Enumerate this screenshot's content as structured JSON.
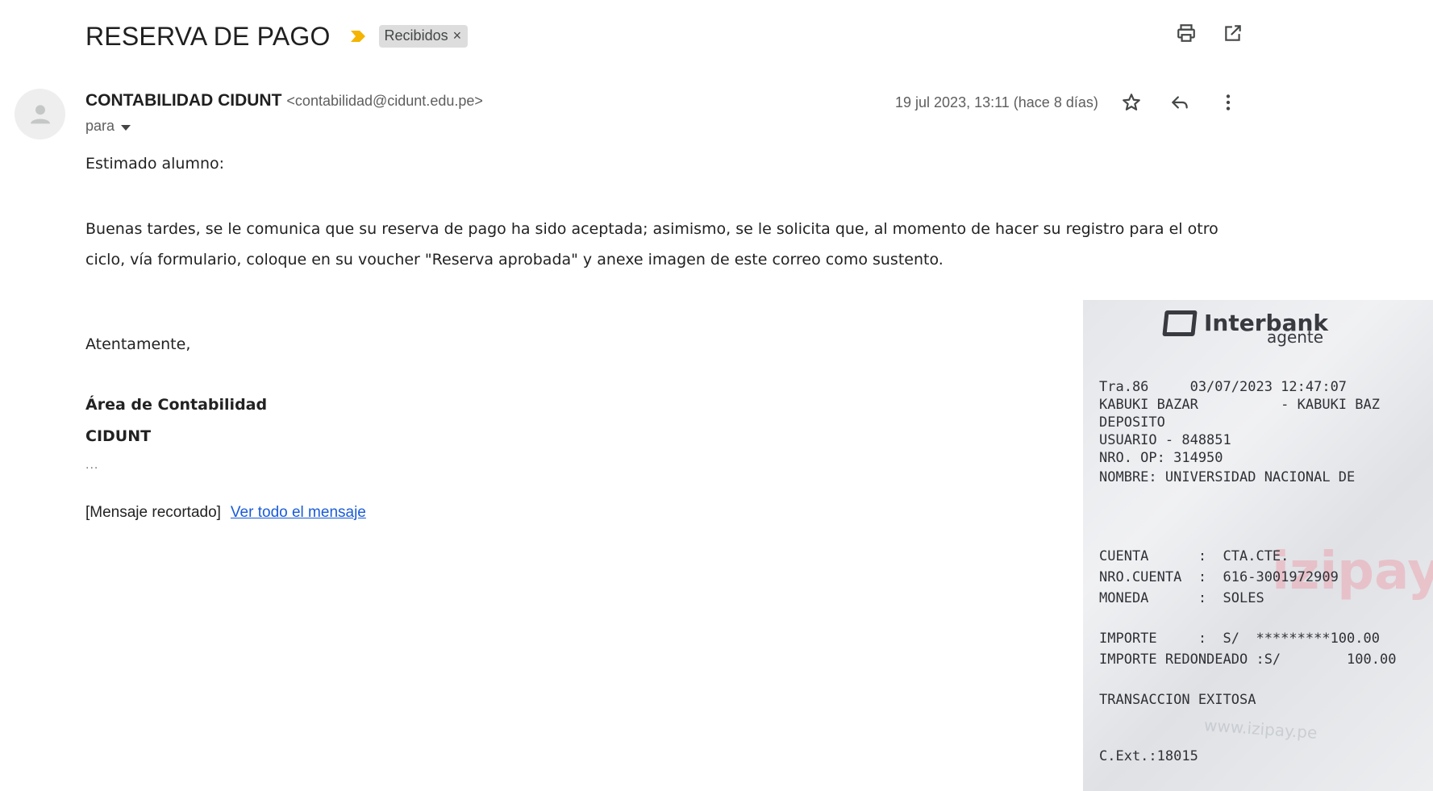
{
  "header": {
    "subject": "RESERVA DE PAGO",
    "label": "Recibidos",
    "label_close": "×",
    "importance_color": "#f4b400"
  },
  "message": {
    "sender_name": "CONTABILIDAD CIDUNT",
    "sender_email": "<contabilidad@cidunt.edu.pe>",
    "to_label": "para",
    "date": "19 jul 2023, 13:11 (hace 8 días)",
    "greeting": "Estimado alumno:",
    "paragraph": "Buenas tardes, se le comunica que su reserva de pago ha sido aceptada; asimismo, se le solicita que, al momento de hacer su registro para el otro ciclo, vía formulario, coloque en su voucher \"Reserva aprobada\" y anexe imagen de este correo como sustento.",
    "closing": "Atentamente,",
    "signature_dept": "Área de Contabilidad",
    "signature_org": "CIDUNT",
    "ellipsis": "...",
    "clipped_text": "[Mensaje recortado]",
    "view_all_link": "Ver todo el mensaje"
  },
  "receipt": {
    "brand": "Interbank",
    "brand_sub": "agente",
    "lines": [
      "Tra.86     03/07/2023 12:47:07",
      "KABUKI BAZAR          - KABUKI BAZ",
      "DEPOSITO",
      "USUARIO - 848851",
      "NRO. OP: 314950",
      "NOMBRE: UNIVERSIDAD NACIONAL DE",
      "CUENTA      :  CTA.CTE.",
      "NRO.CUENTA  :  616-3001972909",
      "MONEDA      :  SOLES",
      "IMPORTE     :  S/  *********100.00",
      "IMPORTE REDONDEADO :S/        100.00",
      "TRANSACCION EXITOSA",
      "C.Ext.:18015"
    ],
    "bg_text_1": "izipay",
    "bg_text_2": "www.izipay.pe"
  },
  "icons": {
    "print": "print-icon",
    "open_new": "open-in-new-window-icon",
    "star": "star-icon",
    "reply": "reply-icon",
    "more": "more-vertical-icon",
    "avatar": "person-icon",
    "importance": "importance-marker-icon"
  }
}
